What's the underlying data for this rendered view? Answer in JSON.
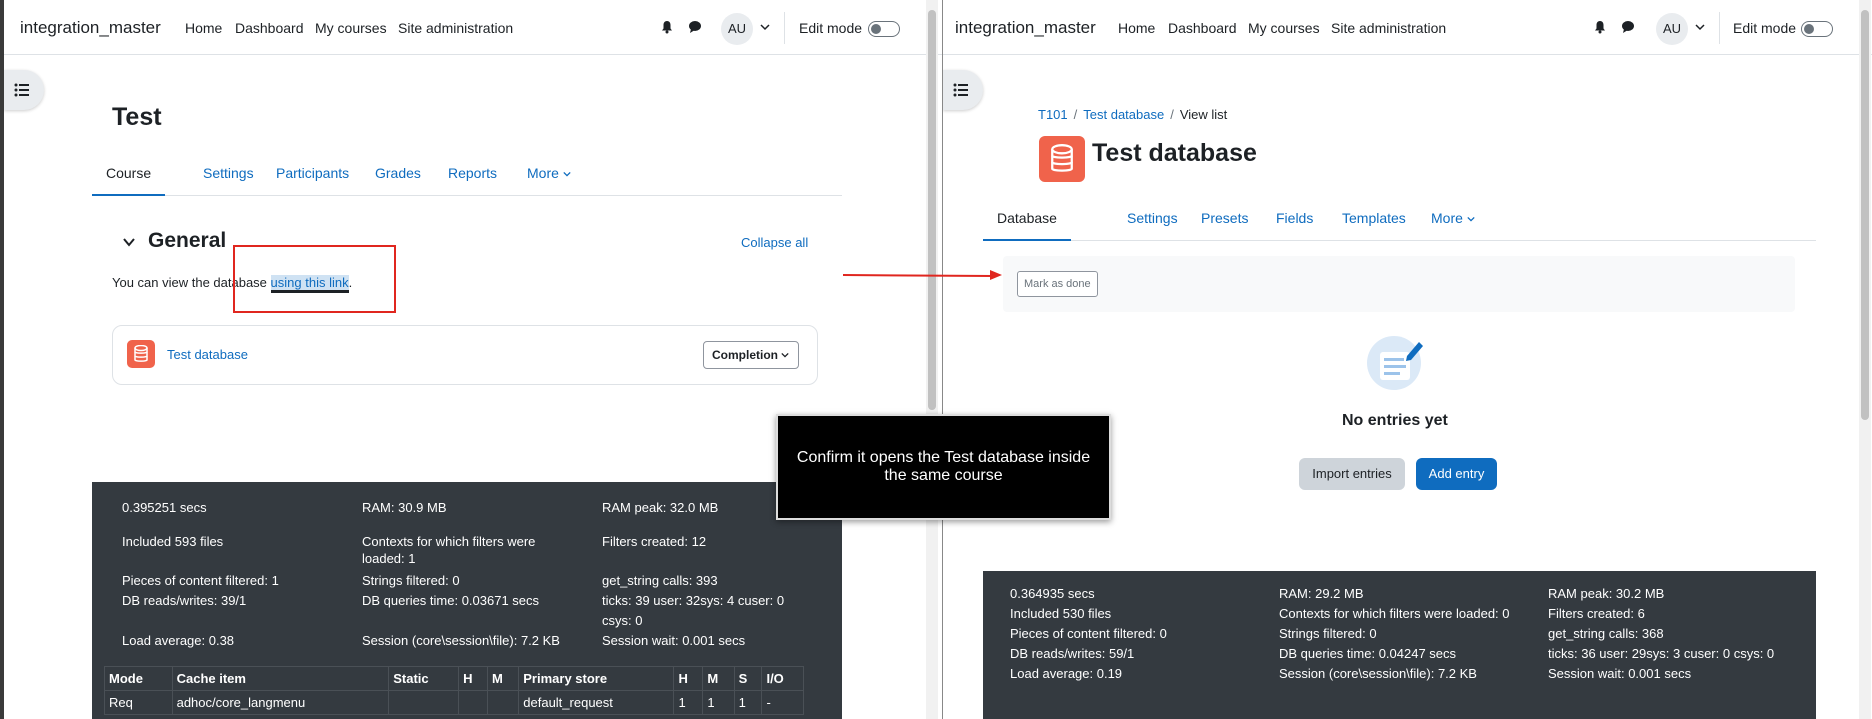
{
  "left": {
    "navbar": {
      "site_name": "integration_master",
      "links": [
        "Home",
        "Dashboard",
        "My courses",
        "Site administration"
      ],
      "avatar": "AU",
      "edit_mode_label": "Edit mode"
    },
    "page_title": "Test",
    "tabs": [
      "Course",
      "Settings",
      "Participants",
      "Grades",
      "Reports",
      "More"
    ],
    "section": {
      "title": "General",
      "collapse_label": "Collapse all",
      "text_before": "You can view the database ",
      "link_text": "using this link",
      "text_after": "."
    },
    "activity": {
      "name": "Test database",
      "completion_label": "Completion"
    },
    "footer": {
      "stats": [
        [
          "0.395251 secs",
          "RAM: 30.9 MB",
          "RAM peak: 32.0 MB"
        ],
        [
          "Included 593 files",
          "Contexts for which filters were",
          "Filters created: 12"
        ],
        [
          "",
          "loaded: 1",
          ""
        ],
        [
          "Pieces of content filtered: 1",
          "Strings filtered: 0",
          "get_string calls: 393"
        ],
        [
          "DB reads/writes: 39/1",
          "DB queries time: 0.03671 secs",
          "ticks: 39 user: 32sys: 4 cuser: 0"
        ],
        [
          "",
          "",
          "csys: 0"
        ],
        [
          "Load average: 0.38",
          "Session (core\\session\\file): 7.2 KB",
          "Session wait: 0.001 secs"
        ]
      ],
      "table_headers": [
        "Mode",
        "Cache item",
        "Static",
        "H",
        "M",
        "Primary store",
        "H",
        "M",
        "S",
        "I/O"
      ],
      "table_rows": [
        [
          "Req",
          "adhoc/core_langmenu",
          "",
          "",
          "",
          "default_request",
          "1",
          "1",
          "1",
          "-"
        ]
      ]
    }
  },
  "right": {
    "navbar": {
      "site_name": "integration_master",
      "links": [
        "Home",
        "Dashboard",
        "My courses",
        "Site administration"
      ],
      "avatar": "AU",
      "edit_mode_label": "Edit mode"
    },
    "breadcrumb": [
      "T101",
      "Test database",
      "View list"
    ],
    "page_title": "Test database",
    "tabs": [
      "Database",
      "Settings",
      "Presets",
      "Fields",
      "Templates",
      "More"
    ],
    "mark_done_label": "Mark as done",
    "empty_title": "No entries yet",
    "import_label": "Import entries",
    "add_label": "Add entry",
    "footer": {
      "stats": [
        [
          "0.364935 secs",
          "RAM: 29.2 MB",
          "RAM peak: 30.2 MB"
        ],
        [
          "Included 530 files",
          "Contexts for which filters were loaded: 0",
          "Filters created: 6"
        ],
        [
          "Pieces of content filtered: 0",
          "Strings filtered: 0",
          "get_string calls: 368"
        ],
        [
          "DB reads/writes: 59/1",
          "DB queries time: 0.04247 secs",
          "ticks: 36 user: 29sys: 3 cuser: 0 csys: 0"
        ],
        [
          "Load average: 0.19",
          "Session (core\\session\\file): 7.2 KB",
          "Session wait: 0.001 secs"
        ]
      ]
    }
  },
  "callout": "Confirm it opens the Test database inside the same course",
  "colors": {
    "link": "#0f6cbf",
    "module_icon": "#f0634b",
    "annotation_red": "#e0261f",
    "footer_bg": "#343a40"
  }
}
